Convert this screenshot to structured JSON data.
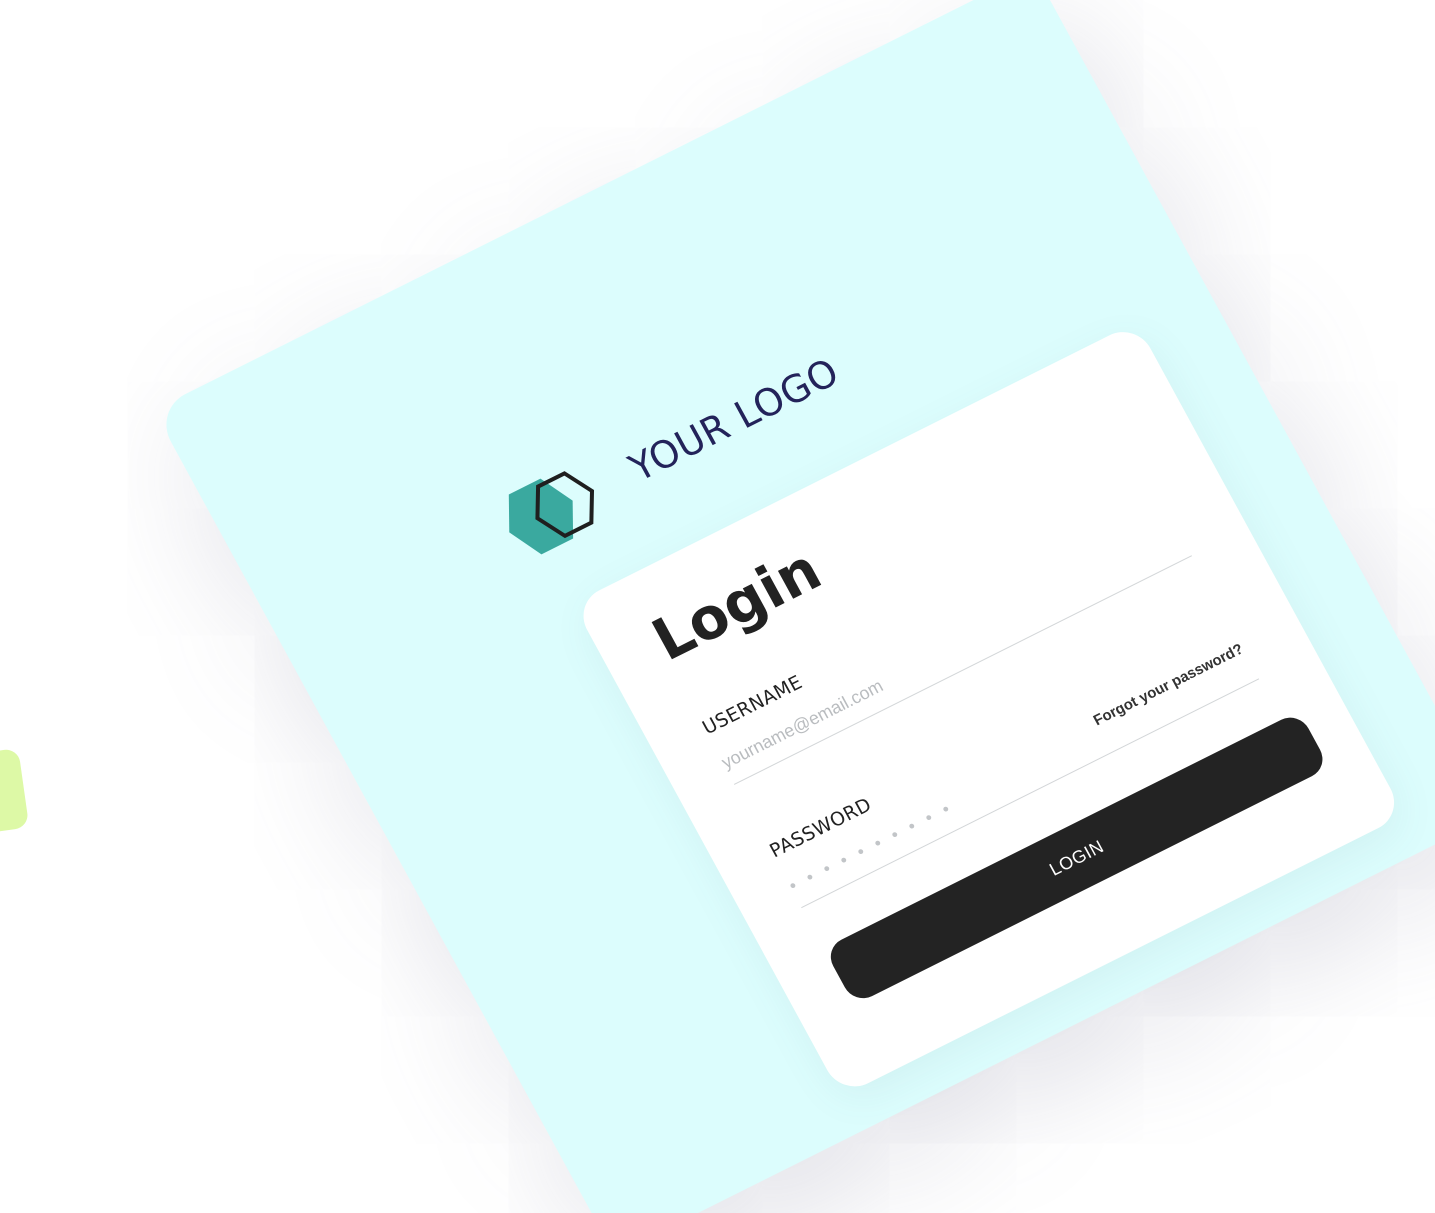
{
  "brand": {
    "logo_text": "YOUR LOGO",
    "logo_icon": "hexagon-icon",
    "colors": {
      "hexagon_fill": "#3aa99f",
      "hexagon_outline": "#1f1f1f",
      "logo_text": "#23235a",
      "panel_background": "#dcfdfd",
      "card_background": "#ffffff",
      "button_background": "#232323",
      "button_text": "#ffffff",
      "side_chip": "#ddf9a6"
    }
  },
  "login_form": {
    "title": "Login",
    "username": {
      "label": "USERNAME",
      "placeholder": "yourname@email.com",
      "value": ""
    },
    "password": {
      "label": "PASSWORD",
      "placeholder": "• • • • • • • • • •",
      "value": ""
    },
    "forgot_password_label": "Forgot your password?",
    "submit_label": "LOGIN"
  }
}
